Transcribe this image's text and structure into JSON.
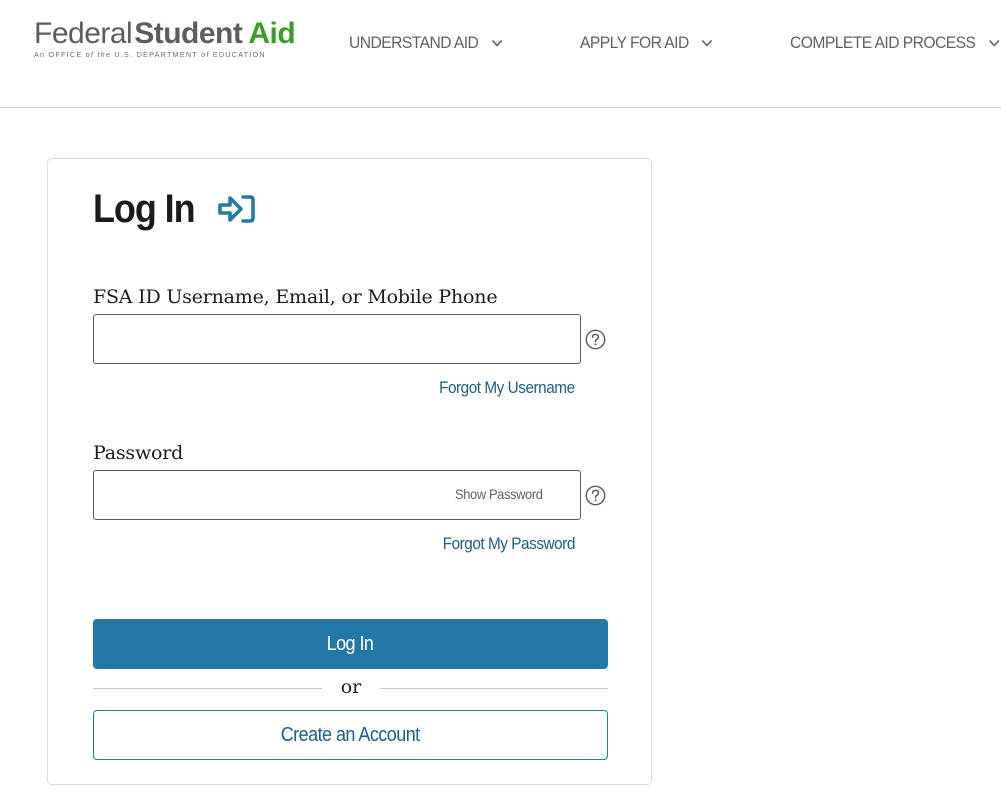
{
  "header": {
    "logo": {
      "word1": "Federal",
      "word2": "Student",
      "word3": "Aid",
      "tagline_prefix": "An OFFICE ",
      "tagline_of1": "of the",
      "tagline_mid": " U.S. DEPARTMENT ",
      "tagline_of2": "of",
      "tagline_suffix": " EDUCATION"
    },
    "nav": [
      {
        "label": "UNDERSTAND AID",
        "icon": "chevron-down-icon"
      },
      {
        "label": "APPLY FOR AID",
        "icon": "chevron-down-icon"
      },
      {
        "label": "COMPLETE AID PROCESS",
        "icon": "chevron-down-icon"
      }
    ]
  },
  "login": {
    "title": "Log In",
    "title_icon": "login-arrow-icon",
    "username": {
      "label": "FSA ID Username, Email, or Mobile Phone",
      "value": "",
      "placeholder": "",
      "help_icon": "question-circle-icon",
      "forgot_link": "Forgot My Username"
    },
    "password": {
      "label": "Password",
      "value": "",
      "placeholder": "",
      "show_toggle": "Show Password",
      "help_icon": "question-circle-icon",
      "forgot_link": "Forgot My Password"
    },
    "submit_label": "Log In",
    "divider_text": "or",
    "create_account_label": "Create an Account"
  },
  "colors": {
    "primary": "#2378a5",
    "link": "#205d84",
    "logo_green": "#3e9d2a",
    "logo_gray": "#5c5c5c",
    "nav_text": "#5d6166"
  }
}
